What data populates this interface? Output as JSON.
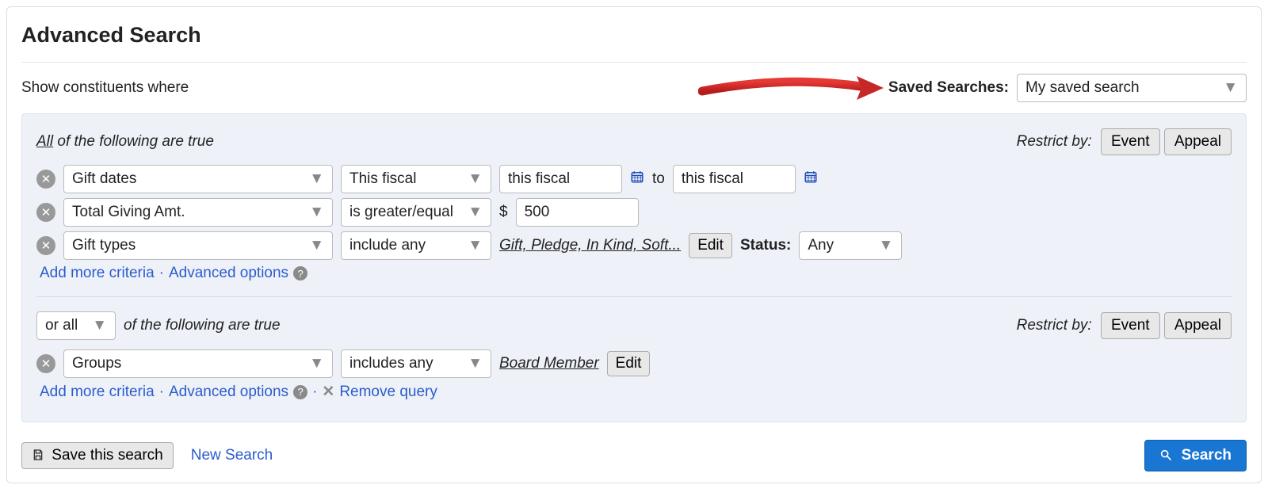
{
  "title": "Advanced Search",
  "subtitle": "Show constituents where",
  "saved": {
    "label": "Saved Searches:",
    "value": "My saved search"
  },
  "restrict_label": "Restrict by:",
  "buttons": {
    "event": "Event",
    "appeal": "Appeal",
    "edit": "Edit",
    "save_search": "Save this search",
    "new_search": "New Search",
    "search": "Search"
  },
  "section1": {
    "prefix_all": "All",
    "suffix": " of the following are true",
    "rows": [
      {
        "field": "Gift dates",
        "range_type": "This fiscal",
        "from": "this fiscal",
        "to_label": "to",
        "to": "this fiscal"
      },
      {
        "field": "Total Giving Amt.",
        "operator": "is greater/equal",
        "currency": "$",
        "amount": "500"
      },
      {
        "field": "Gift types",
        "operator": "include any",
        "values": "Gift, Pledge, In Kind, Soft...",
        "status_label": "Status:",
        "status_value": "Any"
      }
    ],
    "links": {
      "add": "Add more criteria",
      "advanced": "Advanced options"
    }
  },
  "section2": {
    "prefix_select": "or all",
    "suffix": "of the following are true",
    "rows": [
      {
        "field": "Groups",
        "operator": "includes any",
        "values": "Board Member"
      }
    ],
    "links": {
      "add": "Add more criteria",
      "advanced": "Advanced options",
      "remove": "Remove query"
    }
  }
}
